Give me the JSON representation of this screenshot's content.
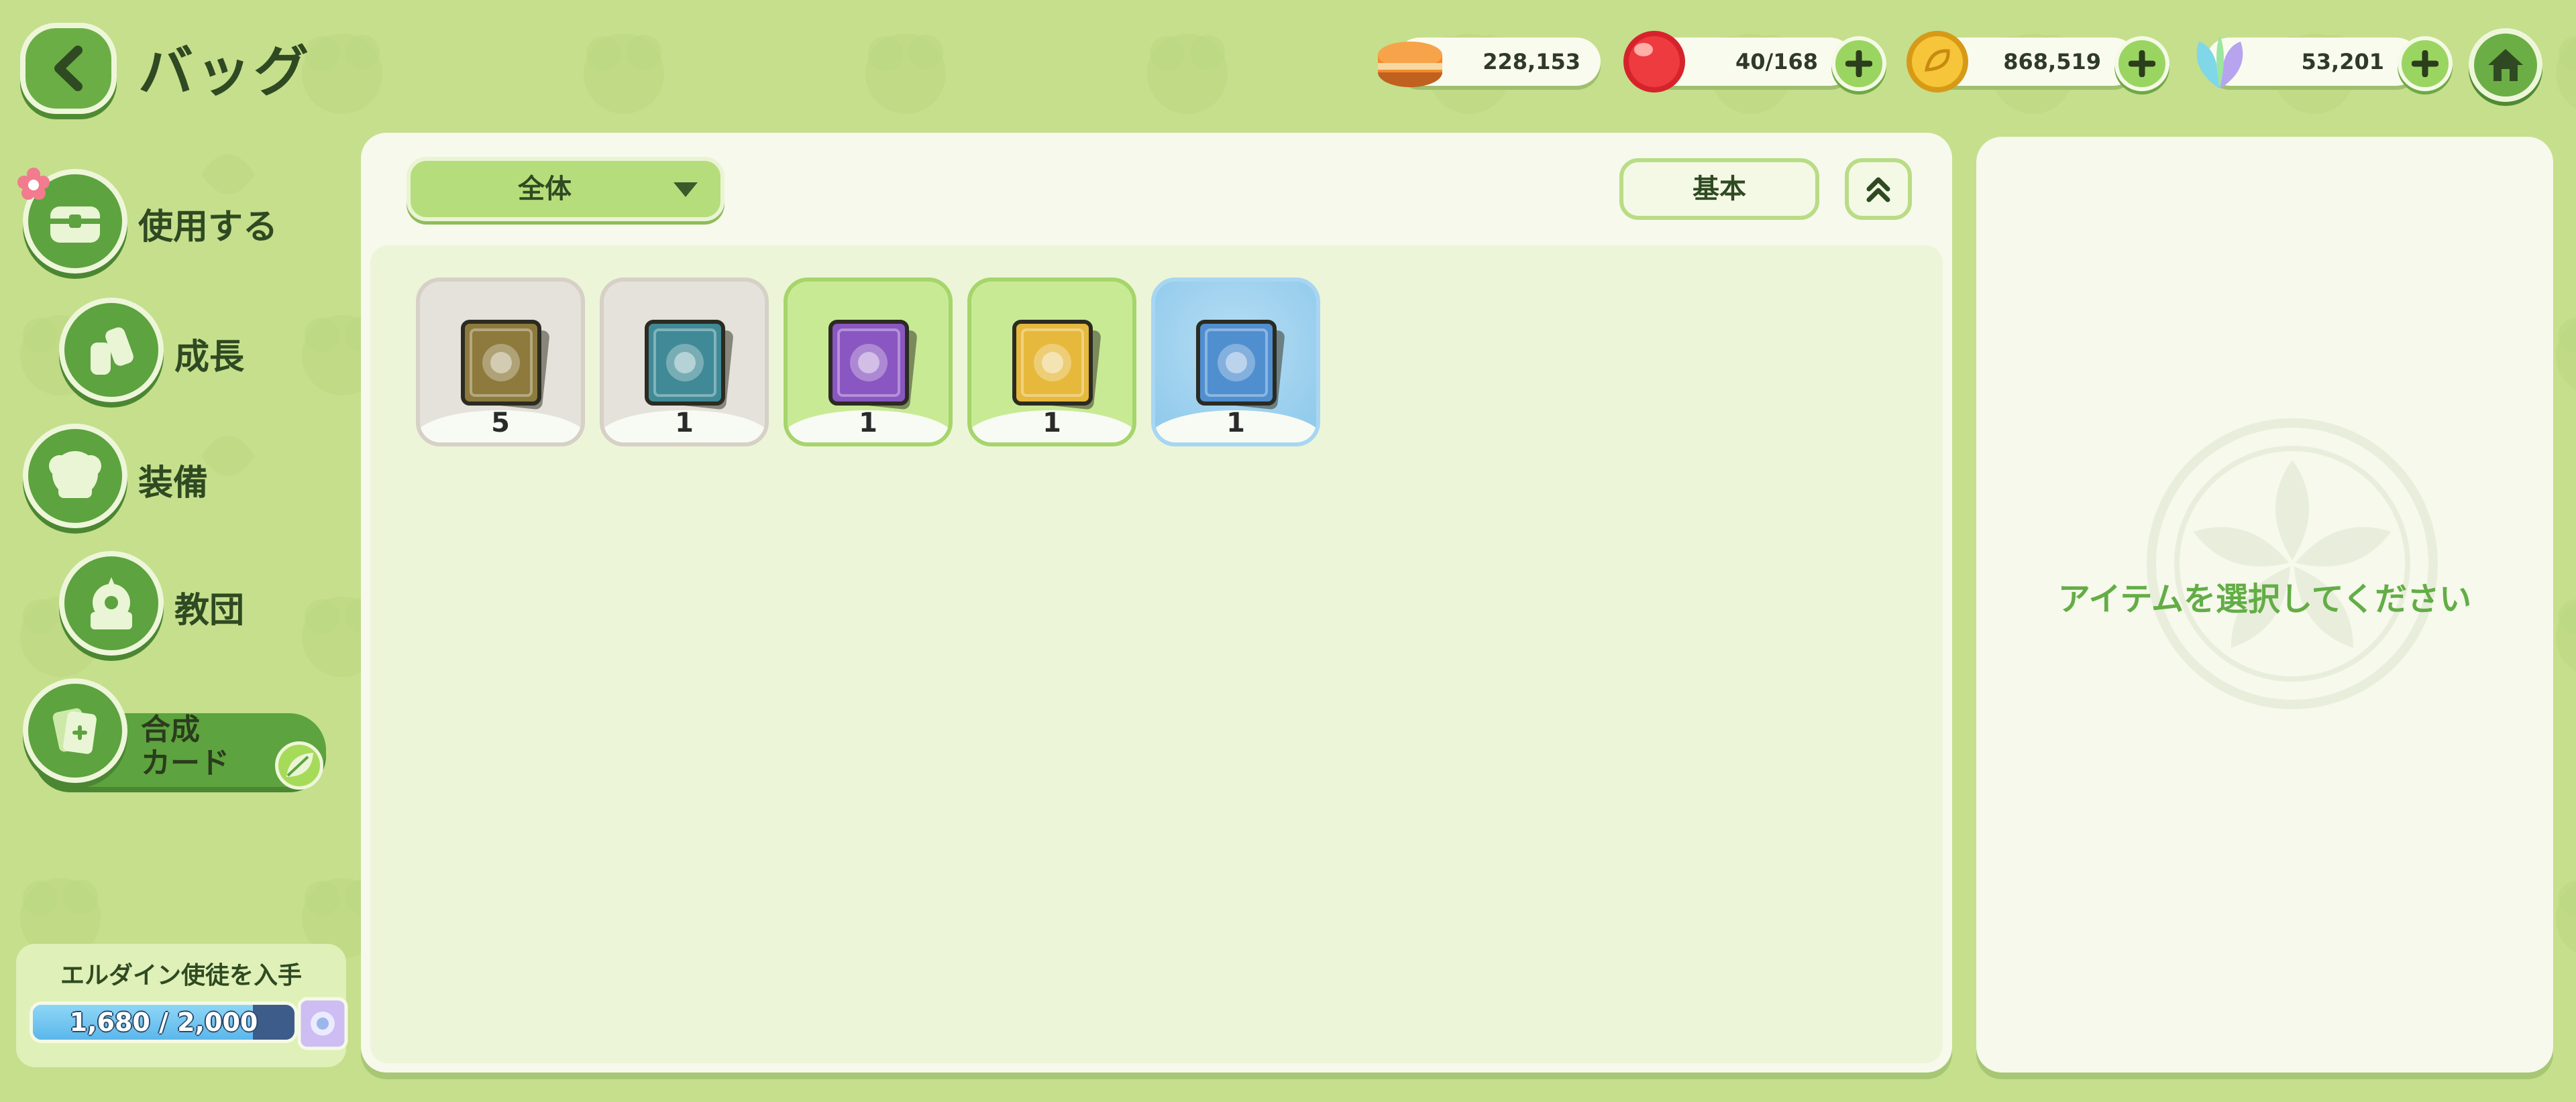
{
  "header": {
    "title": "バッグ"
  },
  "currencies": [
    {
      "name": "pancake",
      "value": "228,153",
      "has_plus": false
    },
    {
      "name": "candy",
      "value": "40/168",
      "has_plus": true
    },
    {
      "name": "gold-coin",
      "value": "868,519",
      "has_plus": true
    },
    {
      "name": "crystal-leaf",
      "value": "53,201",
      "has_plus": true
    }
  ],
  "sidebar": {
    "items": [
      {
        "label": "使用する"
      },
      {
        "label": "成長"
      },
      {
        "label": "装備"
      },
      {
        "label": "教団"
      },
      {
        "label_line1": "合成",
        "label_line2": "カード"
      }
    ],
    "reward": {
      "title": "エルダイン使徒を入手",
      "progress_text": "1,680 / 2,000",
      "progress_fraction": 0.84
    }
  },
  "main": {
    "filter": "全体",
    "sort": "基本",
    "items": [
      {
        "count": "5",
        "rarity": "common",
        "color": "#8d7a3c"
      },
      {
        "count": "1",
        "rarity": "uncommon",
        "color": "#3f8a96"
      },
      {
        "count": "1",
        "rarity": "rare",
        "color": "#8a56c2"
      },
      {
        "count": "1",
        "rarity": "epic",
        "color": "#e6b93c"
      },
      {
        "count": "1",
        "rarity": "legend",
        "color": "#4f8fd0"
      }
    ]
  },
  "detail": {
    "message": "アイテムを選択してください"
  }
}
